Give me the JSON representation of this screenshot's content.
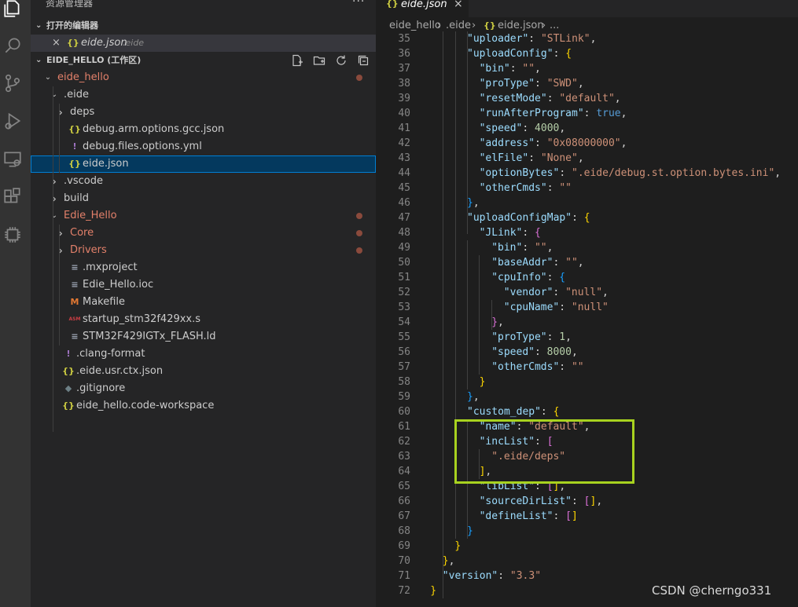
{
  "sidebar": {
    "title": "资源管理器",
    "more": "···",
    "open_editors_header": "打开的编辑器",
    "open_editor": {
      "icon": "{}",
      "name": "eide.json",
      "path": ".eide",
      "close": "×"
    },
    "workspace_header": "EIDE_HELLO (工作区)",
    "tree": [
      {
        "id": "eide_hello",
        "label": "eide_hello",
        "type": "folder",
        "open": true,
        "modified": true
      },
      {
        "id": "eide",
        "label": ".eide",
        "type": "folder",
        "open": true
      },
      {
        "id": "deps",
        "label": "deps",
        "type": "folder",
        "open": false
      },
      {
        "id": "debug_gcc",
        "label": "debug.arm.options.gcc.json",
        "type": "json"
      },
      {
        "id": "debug_files",
        "label": "debug.files.options.yml",
        "type": "yml"
      },
      {
        "id": "eide_json",
        "label": "eide.json",
        "type": "json",
        "selected": true
      },
      {
        "id": "vscode",
        "label": ".vscode",
        "type": "folder",
        "open": false
      },
      {
        "id": "build",
        "label": "build",
        "type": "folder",
        "open": false
      },
      {
        "id": "edie_hello",
        "label": "Edie_Hello",
        "type": "folder",
        "open": true,
        "modified": true
      },
      {
        "id": "core",
        "label": "Core",
        "type": "folder",
        "open": false,
        "modified": true
      },
      {
        "id": "drivers",
        "label": "Drivers",
        "type": "folder",
        "open": false,
        "modified": true
      },
      {
        "id": "mxproject",
        "label": ".mxproject",
        "type": "text"
      },
      {
        "id": "ioc",
        "label": "Edie_Hello.ioc",
        "type": "text"
      },
      {
        "id": "makefile",
        "label": "Makefile",
        "type": "makefile"
      },
      {
        "id": "startup",
        "label": "startup_stm32f429xx.s",
        "type": "asm"
      },
      {
        "id": "ld",
        "label": "STM32F429IGTx_FLASH.ld",
        "type": "text"
      },
      {
        "id": "clang",
        "label": ".clang-format",
        "type": "yml"
      },
      {
        "id": "usrctx",
        "label": ".eide.usr.ctx.json",
        "type": "json"
      },
      {
        "id": "gitignore",
        "label": ".gitignore",
        "type": "git"
      },
      {
        "id": "workspace",
        "label": "eide_hello.code-workspace",
        "type": "json"
      }
    ]
  },
  "editor": {
    "tab": {
      "icon": "{}",
      "name": "eide.json",
      "close": "×"
    },
    "breadcrumb": [
      "eide_hello",
      ".eide",
      "{}",
      "eide.json",
      "..."
    ],
    "first_line": 35,
    "lines": [
      "\"uploader\": \"STLink\",",
      "\"uploadConfig\": {",
      "\"bin\": \"\",",
      "\"proType\": \"SWD\",",
      "\"resetMode\": \"default\",",
      "\"runAfterProgram\": true,",
      "\"speed\": 4000,",
      "\"address\": \"0x08000000\",",
      "\"elFile\": \"None\",",
      "\"optionBytes\": \".eide/debug.st.option.bytes.ini\",",
      "\"otherCmds\": \"\"",
      "},",
      "\"uploadConfigMap\": {",
      "\"JLink\": {",
      "\"bin\": \"\",",
      "\"baseAddr\": \"\",",
      "\"cpuInfo\": {",
      "\"vendor\": \"null\",",
      "\"cpuName\": \"null\"",
      "},",
      "\"proType\": 1,",
      "\"speed\": 8000,",
      "\"otherCmds\": \"\"",
      "}",
      "},",
      "\"custom_dep\": {",
      "\"name\": \"default\",",
      "\"incList\": [",
      "\".eide/deps\"",
      "],",
      "\"libList\": [],",
      "\"sourceDirList\": [],",
      "\"defineList\": []",
      "}",
      "}",
      "},",
      "\"version\": \"3.3\"",
      "}"
    ]
  },
  "watermark": "CSDN @cherngo331",
  "colors": {
    "highlight": "#a8d21f",
    "selection": "#04395e",
    "modified": "#e2806a"
  }
}
